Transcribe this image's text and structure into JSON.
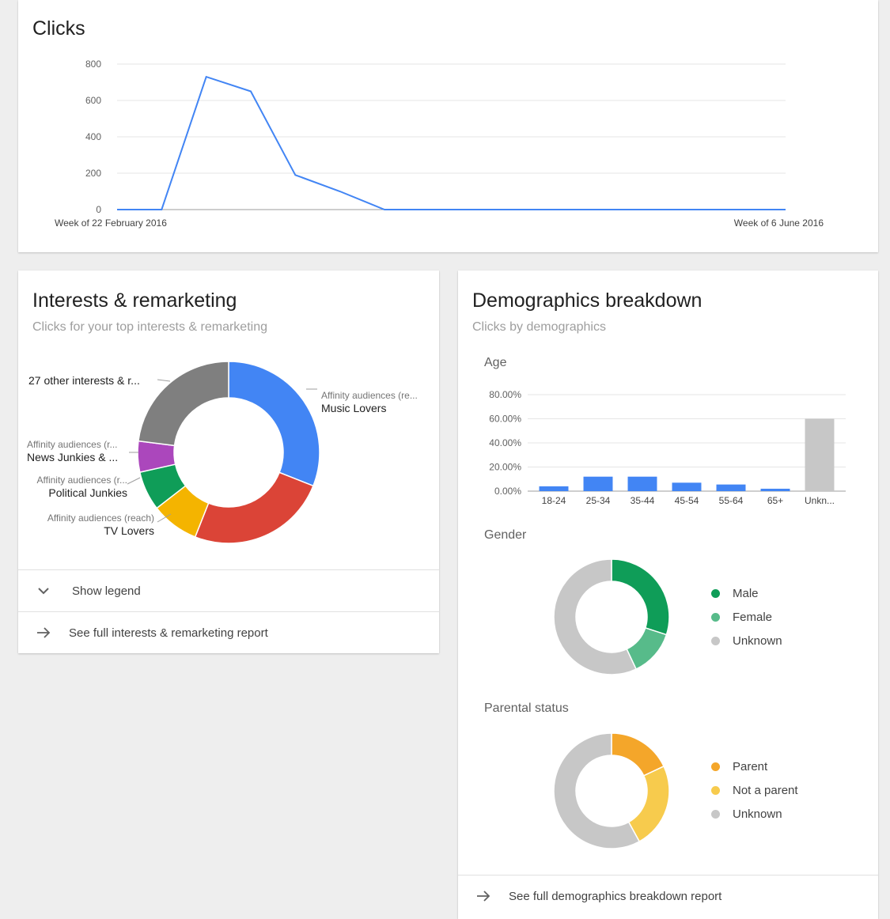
{
  "clicks": {
    "title": "Clicks",
    "x_start_label": "Week of 22 February 2016",
    "x_end_label": "Week of 6 June 2016"
  },
  "interests": {
    "title": "Interests & remarketing",
    "subtitle": "Clicks for your top interests & remarketing",
    "labels": [
      {
        "line1": "Affinity audiences (re...",
        "line2": "Music Lovers"
      },
      {
        "line1": "",
        "line2": "27 other interests & r..."
      },
      {
        "line1": "Affinity audiences (r...",
        "line2": "News Junkies & ..."
      },
      {
        "line1": "Affinity audiences (r...",
        "line2": "Political Junkies"
      },
      {
        "line1": "Affinity audiences (reach)",
        "line2": "TV Lovers"
      }
    ],
    "show_legend": "Show legend",
    "full_report": "See full interests & remarketing report"
  },
  "demographics": {
    "title": "Demographics breakdown",
    "subtitle": "Clicks by demographics",
    "age_label": "Age",
    "gender_label": "Gender",
    "parental_label": "Parental status",
    "gender_legend": [
      {
        "label": "Male",
        "color": "#0f9d58"
      },
      {
        "label": "Female",
        "color": "#57bb8a"
      },
      {
        "label": "Unknown",
        "color": "#c7c7c7"
      }
    ],
    "parental_legend": [
      {
        "label": "Parent",
        "color": "#f4a62a"
      },
      {
        "label": "Not a parent",
        "color": "#f7cb4d"
      },
      {
        "label": "Unknown",
        "color": "#c7c7c7"
      }
    ],
    "full_report": "See full demographics breakdown report"
  },
  "chart_data": [
    {
      "type": "line",
      "title": "Clicks",
      "x_labels": [
        "Week of 22 February 2016",
        "Week of 6 June 2016"
      ],
      "ylim": [
        0,
        800
      ],
      "yticks": [
        "0",
        "200",
        "400",
        "600",
        "800"
      ],
      "color": "#4285f4",
      "series": [
        {
          "values": [
            0,
            0,
            730,
            650,
            190,
            100,
            0,
            0,
            0,
            0,
            0,
            0,
            0,
            0,
            0,
            0
          ]
        }
      ]
    },
    {
      "type": "pie",
      "title": "Interests & remarketing",
      "slices": [
        {
          "label": "Affinity audiences (re... Music Lovers",
          "value": 31,
          "color": "#4285f4"
        },
        {
          "label": "",
          "value": 25,
          "color": "#db4437"
        },
        {
          "label": "Affinity audiences (reach) TV Lovers",
          "value": 8.5,
          "color": "#f4b400"
        },
        {
          "label": "Affinity audiences (r... Political Junkies",
          "value": 7,
          "color": "#0f9d58"
        },
        {
          "label": "Affinity audiences (r... News Junkies & ...",
          "value": 5.5,
          "color": "#ab47bc"
        },
        {
          "label": "27 other interests & r...",
          "value": 23,
          "color": "#7f7f7f"
        }
      ]
    },
    {
      "type": "bar",
      "title": "Age",
      "categories": [
        "18-24",
        "25-34",
        "35-44",
        "45-54",
        "55-64",
        "65+",
        "Unkn..."
      ],
      "values": [
        4,
        12,
        12,
        7,
        5.5,
        2,
        60
      ],
      "colors": [
        "#4285f4",
        "#4285f4",
        "#4285f4",
        "#4285f4",
        "#4285f4",
        "#4285f4",
        "#c7c7c7"
      ],
      "ylim": [
        0,
        80
      ],
      "yticks": [
        "0.00%",
        "20.00%",
        "40.00%",
        "60.00%",
        "80.00%"
      ]
    },
    {
      "type": "pie",
      "title": "Gender",
      "slices": [
        {
          "label": "Male",
          "value": 30,
          "color": "#0f9d58"
        },
        {
          "label": "Female",
          "value": 13,
          "color": "#57bb8a"
        },
        {
          "label": "Unknown",
          "value": 57,
          "color": "#c7c7c7"
        }
      ]
    },
    {
      "type": "pie",
      "title": "Parental status",
      "slices": [
        {
          "label": "Parent",
          "value": 18,
          "color": "#f4a62a"
        },
        {
          "label": "Not a parent",
          "value": 24,
          "color": "#f7cb4d"
        },
        {
          "label": "Unknown",
          "value": 58,
          "color": "#c7c7c7"
        }
      ]
    }
  ]
}
